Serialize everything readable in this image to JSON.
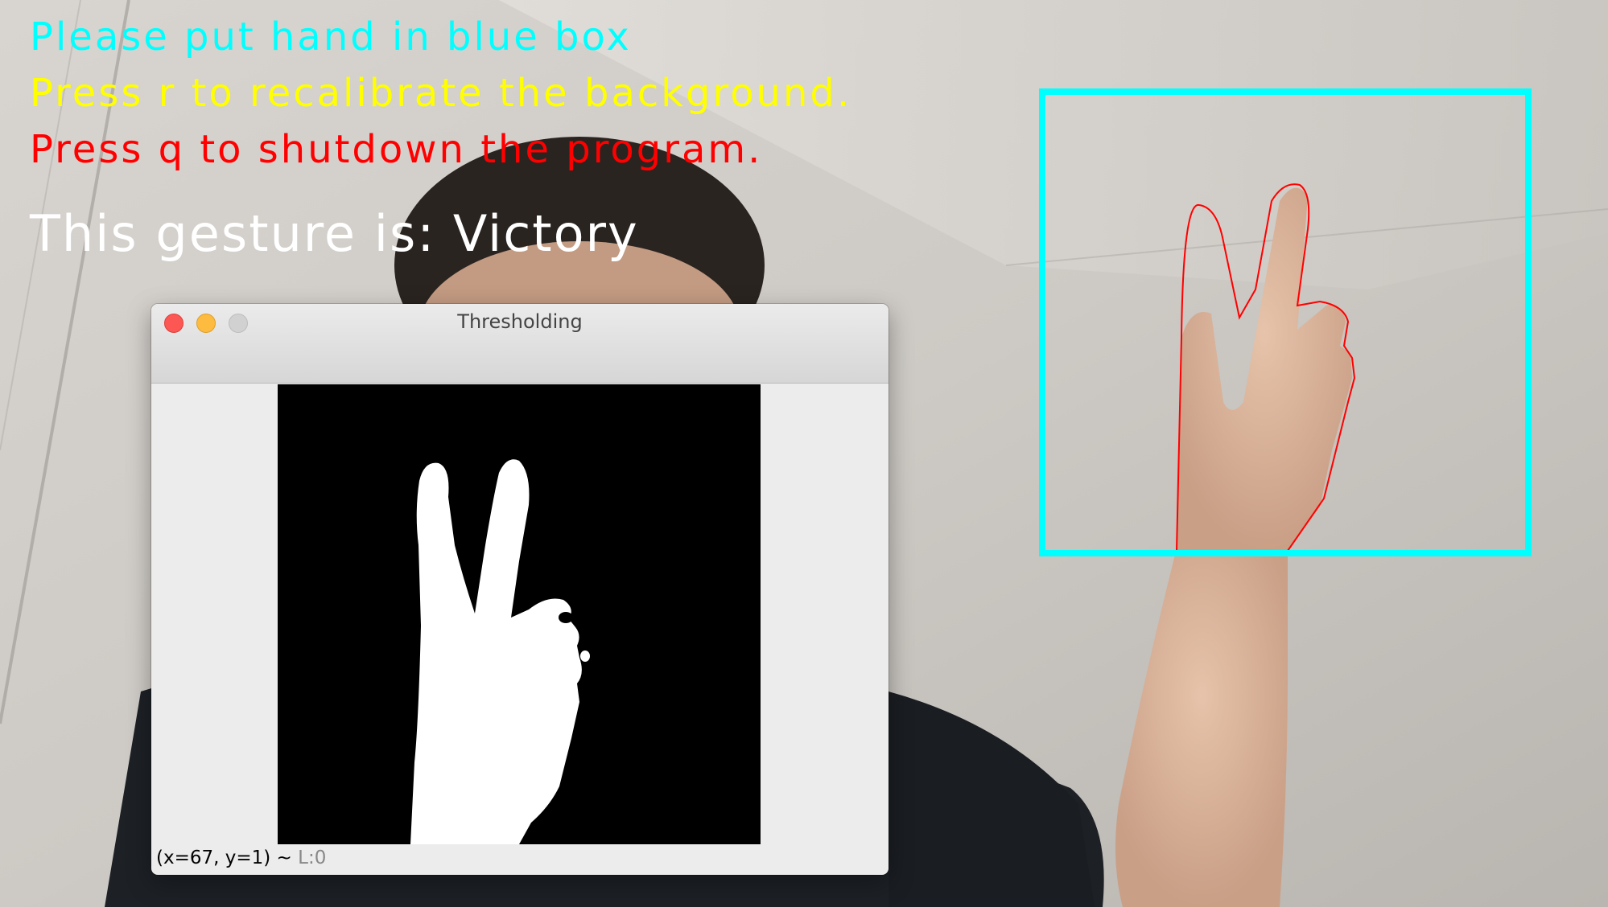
{
  "overlay": {
    "instruction": "Please put hand in blue box",
    "recalibrate": "Press r to recalibrate the background.",
    "shutdown": "Press q to shutdown the program.",
    "gesture_prefix": "This gesture is: ",
    "gesture_value": "Victory",
    "colors": {
      "instruction": "#00ffff",
      "recalibrate": "#ffff00",
      "shutdown": "#ff0000",
      "gesture": "#ffffff",
      "roi_box": "#00ffff",
      "contour": "#ff0000"
    }
  },
  "threshold_window": {
    "title": "Thresholding",
    "status_coords": "(x=67, y=1) ~ ",
    "status_level": "L:0"
  }
}
